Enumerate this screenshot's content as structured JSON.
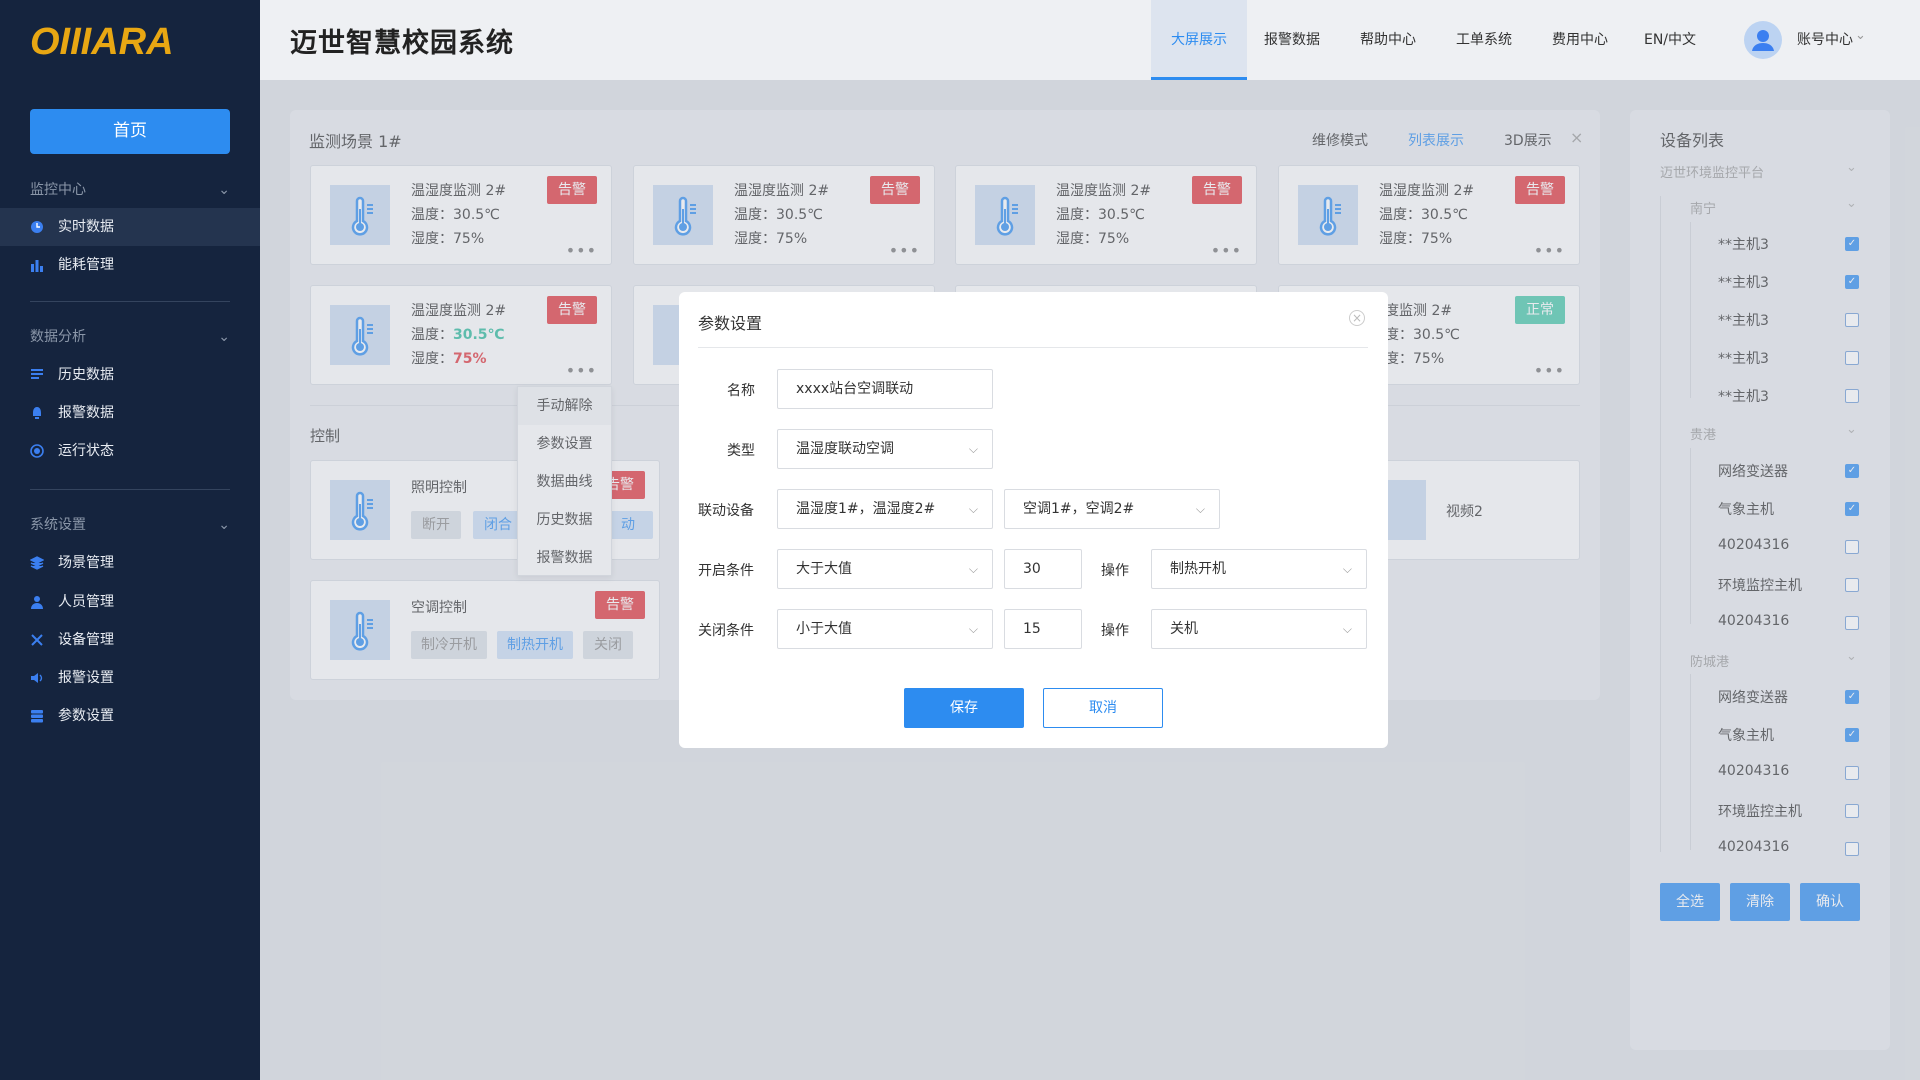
{
  "app": {
    "logo": "OIIIARA",
    "title": "迈世智慧校园系统"
  },
  "sidebar": {
    "home": "首页",
    "sections": [
      {
        "title": "监控中心",
        "items": [
          "实时数据",
          "能耗管理"
        ]
      },
      {
        "title": "数据分析",
        "items": [
          "历史数据",
          "报警数据",
          "运行状态"
        ]
      },
      {
        "title": "系统设置",
        "items": [
          "场景管理",
          "人员管理",
          "设备管理",
          "报警设置",
          "参数设置"
        ]
      }
    ]
  },
  "header": {
    "tabs": [
      "大屏展示",
      "报警数据",
      "帮助中心",
      "工单系统",
      "费用中心",
      "EN/中文"
    ],
    "active_tab": "大屏展示",
    "account": "账号中心"
  },
  "panel": {
    "title": "监测场景 1#",
    "modes": [
      "维修模式",
      "列表展示",
      "3D展示"
    ],
    "active_mode": "列表展示",
    "close": "×",
    "cards": [
      {
        "name": "温湿度监测 2#",
        "temp": "温度：30.5℃",
        "hum": "湿度：75%",
        "badge": "告警"
      },
      {
        "name": "温湿度监测 2#",
        "temp": "温度：30.5℃",
        "hum": "湿度：75%",
        "badge": "告警"
      },
      {
        "name": "温湿度监测 2#",
        "temp": "温度：30.5℃",
        "hum": "湿度：75%",
        "badge": "告警"
      },
      {
        "name": "温湿度监测 2#",
        "temp": "温度：30.5℃",
        "hum": "湿度：75%",
        "badge": "告警"
      },
      {
        "name": "温湿度监测 2#",
        "temp_label": "温度：",
        "temp_value": "30.5℃",
        "hum_label": "湿度：",
        "hum_value": "75%",
        "badge": "告警"
      },
      {
        "name": "度监测 2#",
        "temp": "度：30.5℃",
        "hum": "度：75%",
        "badge": "正常"
      }
    ],
    "dots": "•••",
    "control_title": "控制",
    "light": {
      "name": "照明控制",
      "badge": "告警",
      "buttons": [
        "断开",
        "闭合",
        "动"
      ]
    },
    "ac": {
      "name": "空调控制",
      "badge": "告警",
      "buttons": [
        "制冷开机",
        "制热开机",
        "关闭"
      ]
    },
    "video": {
      "name": "视频2"
    }
  },
  "context_menu": [
    "手动解除",
    "参数设置",
    "数据曲线",
    "历史数据",
    "报警数据"
  ],
  "modal": {
    "title": "参数设置",
    "close": "×",
    "name_label": "名称",
    "name_value": "xxxx站台空调联动",
    "type_label": "类型",
    "type_value": "温湿度联动空调",
    "link_label": "联动设备",
    "link_value1": "温湿度1#，温湿度2#",
    "link_value2": "空调1#，空调2#",
    "open_label": "开启条件",
    "open_cond": "大于大值",
    "open_num": "30",
    "op_label": "操作",
    "open_op": "制热开机",
    "close_label": "关闭条件",
    "close_cond": "小于大值",
    "close_num": "15",
    "close_op": "关机",
    "save": "保存",
    "cancel": "取消"
  },
  "device_list": {
    "title": "设备列表",
    "root": "迈世环境监控平台",
    "groups": [
      {
        "name": "南宁",
        "items": [
          {
            "label": "**主机3",
            "checked": true
          },
          {
            "label": "**主机3",
            "checked": true
          },
          {
            "label": "**主机3",
            "checked": false
          },
          {
            "label": "**主机3",
            "checked": false
          },
          {
            "label": "**主机3",
            "checked": false
          }
        ]
      },
      {
        "name": "贵港",
        "items": [
          {
            "label": "网络变送器",
            "checked": true
          },
          {
            "label": "气象主机",
            "checked": true
          },
          {
            "label": "40204316",
            "checked": false
          },
          {
            "label": "环境监控主机",
            "checked": false
          },
          {
            "label": "40204316",
            "checked": false
          }
        ]
      },
      {
        "name": "防城港",
        "items": [
          {
            "label": "网络变送器",
            "checked": true
          },
          {
            "label": "气象主机",
            "checked": true
          },
          {
            "label": "40204316",
            "checked": false
          },
          {
            "label": "环境监控主机",
            "checked": false
          },
          {
            "label": "40204316",
            "checked": false
          }
        ]
      }
    ],
    "buttons": [
      "全选",
      "清除",
      "确认"
    ]
  },
  "colors": {
    "accent": "#2d8cf0",
    "alarm": "#e0363d",
    "normal": "#45c6a8",
    "sidebar": "#15243e",
    "logo": "#e8a713"
  }
}
